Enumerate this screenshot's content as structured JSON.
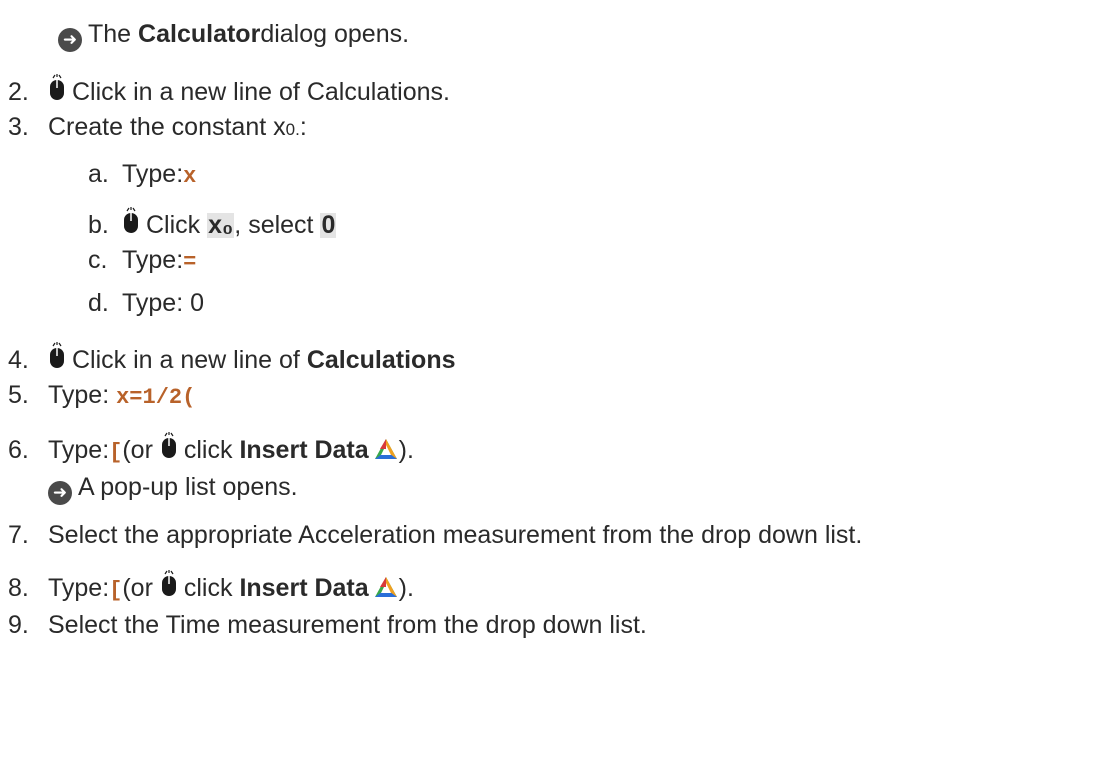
{
  "intro": {
    "prefix": "The ",
    "bold": "Calculator",
    "suffix": " dialog opens."
  },
  "step2": {
    "num": "2.",
    "text": "Click in a new line of Calculations."
  },
  "step3": {
    "num": "3.",
    "text": "Create the constant x",
    "sub": "0.",
    "colon": ":"
  },
  "step3a": {
    "num": "a.",
    "text": "Type: ",
    "code": "x"
  },
  "step3b": {
    "num": "b.",
    "text": "Click ",
    "btn": "x₀",
    "mid": ", select ",
    "val": "0"
  },
  "step3c": {
    "num": "c.",
    "text": "Type: ",
    "code": "="
  },
  "step3d": {
    "num": "d.",
    "text": "Type: 0"
  },
  "step4": {
    "num": "4.",
    "text": "Click in a new line of ",
    "bold": "Calculations"
  },
  "step5": {
    "num": "5.",
    "text": "Type: ",
    "code": "x=1/2("
  },
  "step6": {
    "num": "6.",
    "text": "Type: ",
    "code": "[",
    "mid": " (or ",
    "mid2": "click ",
    "bold": "Insert Data",
    "end": ")."
  },
  "step6result": {
    "text": "A pop-up list opens."
  },
  "step7": {
    "num": "7.",
    "text": "Select the appropriate Acceleration measurement from the drop down list."
  },
  "step8": {
    "num": "8.",
    "text": "Type: ",
    "code": "[",
    "mid": " (or ",
    "mid2": "click ",
    "bold": "Insert Data",
    "end": ")."
  },
  "step9": {
    "num": "9.",
    "text": "Select the Time measurement from the drop down list."
  },
  "icons": {
    "result": "arrow-right-circle-icon",
    "click": "mouse-icon",
    "insert": "insert-data-icon"
  }
}
